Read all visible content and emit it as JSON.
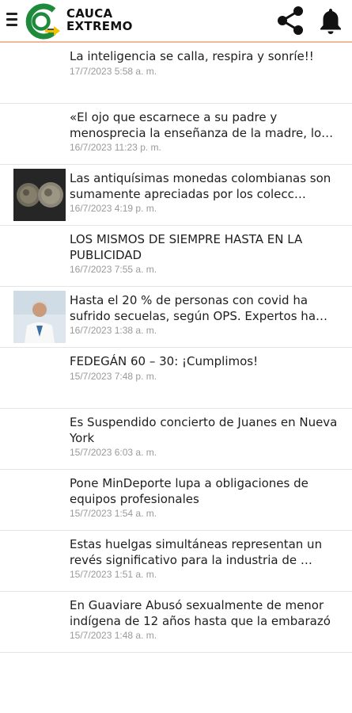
{
  "app": {
    "brand_line1": "CAUCA",
    "brand_line2": "EXTREMO",
    "accent": "#f0b79a",
    "logo_green": "#1e8a3c",
    "logo_yellow": "#f2c200"
  },
  "icons": {
    "menu": "hamburger-menu",
    "share": "share",
    "notifications": "bell"
  },
  "news": [
    {
      "title": "La inteligencia se calla, respira y sonríe!!",
      "date": "17/7/2023 5:58 a. m.",
      "thumb": ""
    },
    {
      "title": "«El ojo que escarnece a su padre y menosprecia la enseñanza de la madre, lo…",
      "date": "16/7/2023 11:23 p. m.",
      "thumb": ""
    },
    {
      "title": "Las antiquísimas monedas colombianas son sumamente apreciadas por los colecc…",
      "date": "16/7/2023 4:19 p. m.",
      "thumb": "coins-photo"
    },
    {
      "title": "LOS MISMOS DE SIEMPRE HASTA EN LA PUBLICIDAD",
      "date": "16/7/2023 7:55 a. m.",
      "thumb": ""
    },
    {
      "title": "Hasta el 20 % de personas con covid ha sufrido secuelas, según OPS. Expertos ha…",
      "date": "16/7/2023 1:38 a. m.",
      "thumb": "doctor-photo"
    },
    {
      "title": "FEDEGÁN 60 – 30: ¡Cumplimos!",
      "date": "15/7/2023 7:48 p. m.",
      "thumb": ""
    },
    {
      "title": "Es Suspendido concierto de Juanes en Nueva York",
      "date": "15/7/2023 6:03 a. m.",
      "thumb": ""
    },
    {
      "title": "Pone MinDeporte lupa a obligaciones de equipos profesionales",
      "date": "15/7/2023 1:54 a. m.",
      "thumb": ""
    },
    {
      "title": "Estas huelgas simultáneas representan un revés significativo para la industria de …",
      "date": "15/7/2023 1:51 a. m.",
      "thumb": ""
    },
    {
      "title": "En Guaviare Abusó sexualmente de menor indígena de 12 años hasta que la embarazó",
      "date": "15/7/2023 1:48 a. m.",
      "thumb": ""
    }
  ]
}
